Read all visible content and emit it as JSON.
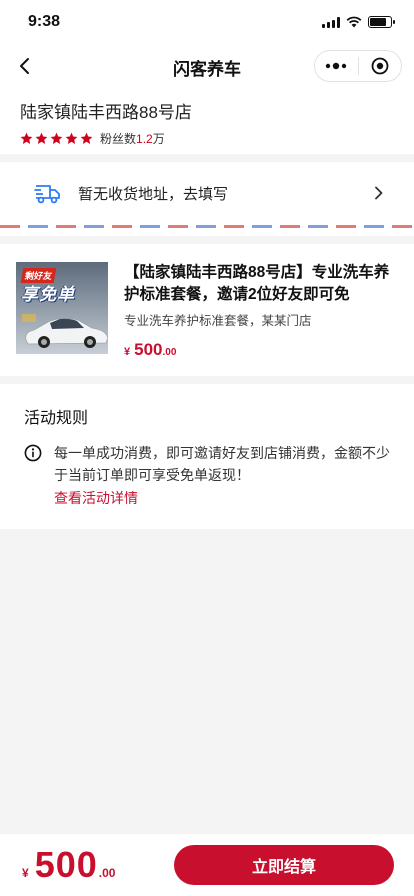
{
  "status_bar": {
    "time": "9:38",
    "battery_level": 0.8
  },
  "nav": {
    "title": "闪客养车"
  },
  "store": {
    "name": "陆家镇陆丰西路88号店",
    "rating_stars": 5,
    "fans_label": "粉丝数",
    "fans_count": "1.2",
    "fans_unit": "万"
  },
  "address": {
    "placeholder_text": "暂无收货地址，去填写"
  },
  "product": {
    "thumb_tag": "剩好友",
    "thumb_title": "享免单",
    "title": "【陆家镇陆丰西路88号店】专业洗车养护标准套餐，邀请2位好友即可免",
    "desc": "专业洗车养护标准套餐，某某门店",
    "price_symbol": "¥",
    "price_int": "500",
    "price_dec": ".00"
  },
  "rules": {
    "title": "活动规则",
    "text": "每一单成功消费，即可邀请好友到店铺消费，金额不少于当前订单即可享受免单返现！",
    "link": "查看活动详情"
  },
  "bottom": {
    "price_symbol": "¥",
    "price_int": "500",
    "price_dec": ".00",
    "checkout_label": "立即结算"
  },
  "colors": {
    "accent": "#c80f2e",
    "star": "#d0021b",
    "icon_blue": "#2f7cf6"
  }
}
